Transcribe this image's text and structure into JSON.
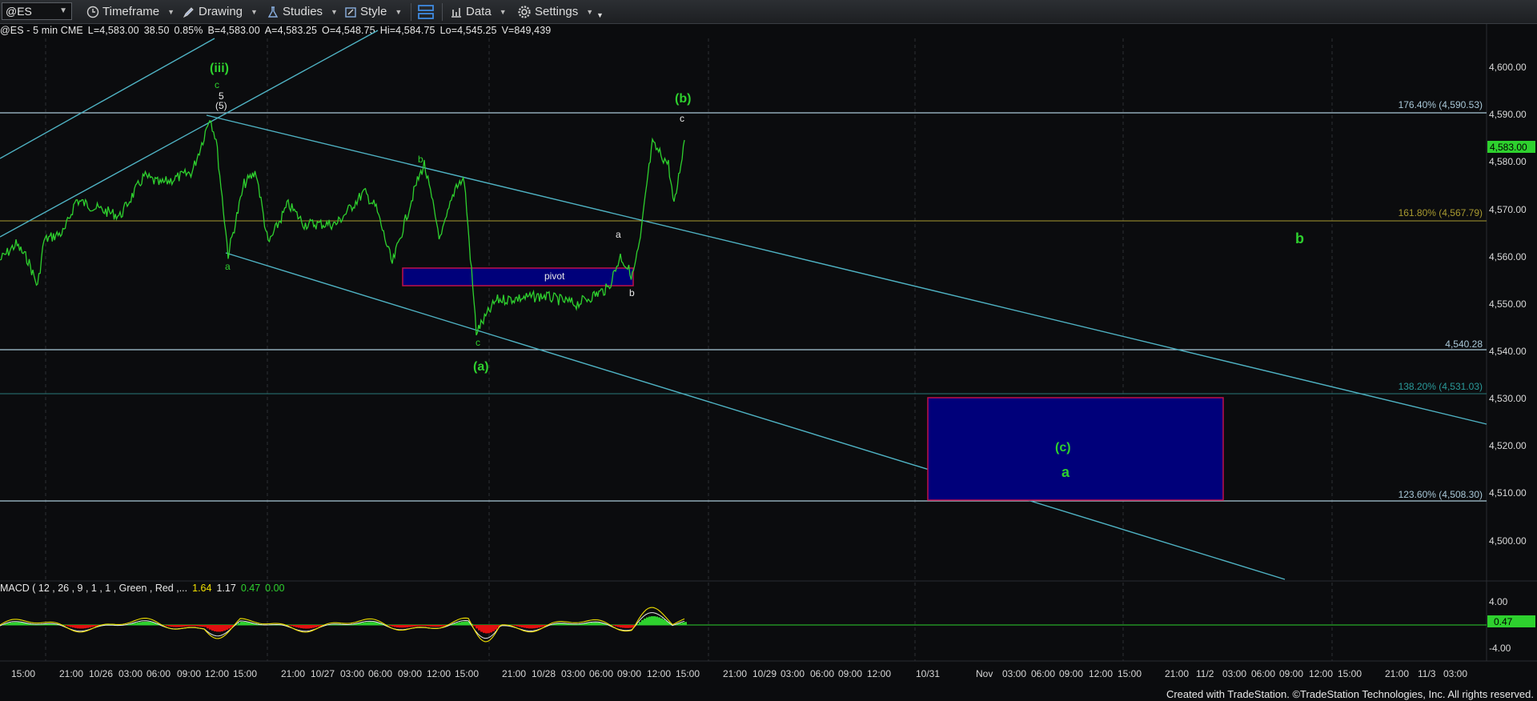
{
  "toolbar": {
    "symbol": "@ES",
    "timeframe_label": "Timeframe",
    "drawing_label": "Drawing",
    "studies_label": "Studies",
    "style_label": "Style",
    "data_label": "Data",
    "settings_label": "Settings"
  },
  "infoline": {
    "symbol_desc": "@ES - 5 min  CME",
    "last": "L=4,583.00",
    "change": "38.50",
    "change_pct": "0.85%",
    "bid": "B=4,583.00",
    "ask": "A=4,583.25",
    "open": "O=4,548.75",
    "high": "Hi=4,584.75",
    "low": "Lo=4,545.25",
    "volume": "V=849,439"
  },
  "price_axis": {
    "ticks": [
      "4,600.00",
      "4,590.00",
      "4,580.00",
      "4,570.00",
      "4,560.00",
      "4,550.00",
      "4,540.00",
      "4,530.00",
      "4,520.00",
      "4,510.00",
      "4,500.00"
    ],
    "last_price_badge": "4,583.00"
  },
  "fib_levels": [
    {
      "label": "176.40% (4,590.53)",
      "price": 4590.53,
      "color": "#a9c8d8"
    },
    {
      "label": "161.80% (4,567.79)",
      "price": 4567.79,
      "color": "#a89a30"
    },
    {
      "label": "4,540.28",
      "price": 4540.28,
      "color": "#a9c8d8"
    },
    {
      "label": "138.20% (4,531.03)",
      "price": 4531.03,
      "color": "#2a7a7a"
    },
    {
      "label": "123.60% (4,508.30)",
      "price": 4508.3,
      "color": "#a9c8d8"
    }
  ],
  "annotations": {
    "pivot": "pivot",
    "wave_iii": "(iii)",
    "wave_b_paren": "(b)",
    "wave_a_paren": "(a)",
    "wave_c_paren": "(c)",
    "wave_b": "b",
    "wave_a": "a",
    "sub_c_top": "c",
    "sub_5": "5",
    "sub_5_paren": "(5)",
    "sub_a_1": "a",
    "sub_b_1": "b",
    "sub_c_1": "c",
    "sub_a_2": "a",
    "sub_b_2": "b",
    "sub_c_2": "c"
  },
  "time_axis": {
    "labels": [
      "15:00",
      "21:00",
      "10/26",
      "03:00",
      "06:00",
      "09:00",
      "12:00",
      "15:00",
      "21:00",
      "10/27",
      "03:00",
      "06:00",
      "09:00",
      "12:00",
      "15:00",
      "21:00",
      "10/28",
      "03:00",
      "06:00",
      "09:00",
      "12:00",
      "15:00",
      "21:00",
      "10/29",
      "03:00",
      "06:00",
      "09:00",
      "12:00",
      "10/31",
      "Nov",
      "03:00",
      "06:00",
      "09:00",
      "12:00",
      "15:00",
      "21:00",
      "11/2",
      "03:00",
      "06:00",
      "09:00",
      "12:00",
      "15:00",
      "21:00",
      "11/3",
      "03:00"
    ]
  },
  "macd": {
    "title": "MACD ( 12 , 26 , 9 , 1 , 1 , Green , Red ,...",
    "macd_value": "1.64",
    "signal_value": "1.17",
    "hist_value": "0.47",
    "zero_value": "0.00",
    "axis_ticks": [
      "4.00",
      "-4.00"
    ],
    "badge": "0.47"
  },
  "footer": {
    "credit": "Created with TradeStation. ©TradeStation Technologies, Inc. All rights reserved."
  },
  "colors": {
    "price_line": "#2ed12e",
    "channel": "#4fb3c4",
    "pivot_fill": "#00007a",
    "pivot_border": "#c0104a",
    "macd_line": "#f0e000",
    "signal_line": "#e8e8e8",
    "hist_up": "#2ed12e",
    "hist_down": "#e01010"
  }
}
